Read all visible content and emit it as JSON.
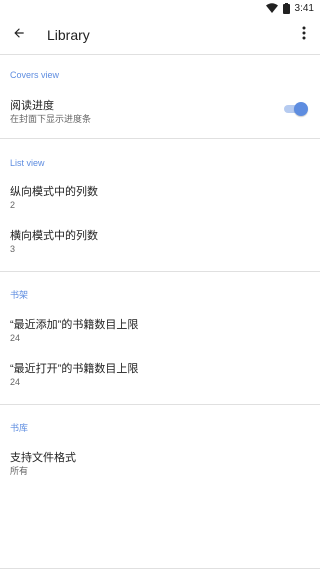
{
  "status_bar": {
    "time": "3:41",
    "icons": [
      "wifi-icon",
      "battery-icon"
    ]
  },
  "app_bar": {
    "title": "Library",
    "back_icon": "arrow-back-icon",
    "more_icon": "more-vert-icon"
  },
  "colors": {
    "accent": "#5e8de0",
    "toggle_track": "#b6cbf0",
    "divider": "#e0e0e0"
  },
  "sections": {
    "covers_view": {
      "header": "Covers view",
      "reading_progress": {
        "title": "阅读进度",
        "summary": "在封面下显示进度条",
        "enabled": true
      }
    },
    "list_view": {
      "header": "List view",
      "portrait_columns": {
        "title": "纵向模式中的列数",
        "value": "2"
      },
      "landscape_columns": {
        "title": "横向模式中的列数",
        "value": "3"
      }
    },
    "shelf": {
      "header": "书架",
      "recently_added_limit": {
        "title": "“最近添加”的书籍数目上限",
        "value": "24"
      },
      "recently_opened_limit": {
        "title": "“最近打开”的书籍数目上限",
        "value": "24"
      }
    },
    "library": {
      "header": "书库",
      "supported_formats": {
        "title": "支持文件格式",
        "value": "所有"
      }
    }
  }
}
